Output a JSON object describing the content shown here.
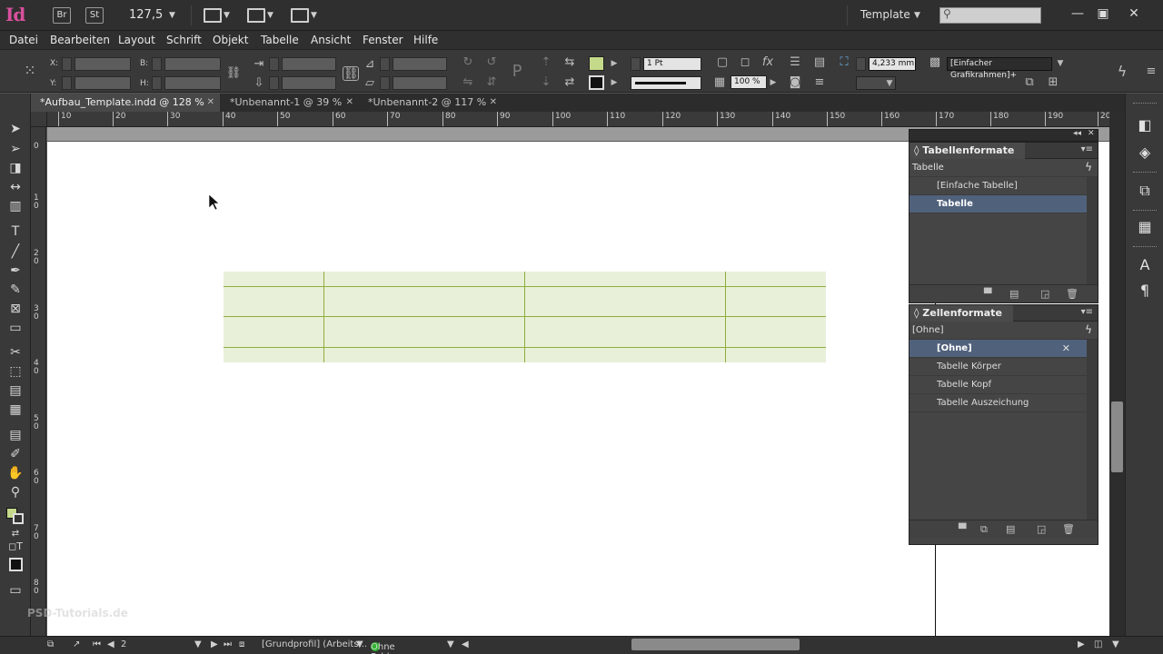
{
  "app": {
    "logo": "Id",
    "bridge_label": "Br",
    "stock_label": "St",
    "zoom": "127,5",
    "workspace": "Template",
    "window_controls": [
      "minimize-icon",
      "restore-icon",
      "close-icon"
    ]
  },
  "menu": [
    "Datei",
    "Bearbeiten",
    "Layout",
    "Schrift",
    "Objekt",
    "Tabelle",
    "Ansicht",
    "Fenster",
    "Hilfe"
  ],
  "control": {
    "x_label": "X:",
    "y_label": "Y:",
    "w_label": "B:",
    "h_label": "H:",
    "stroke_weight": "1 Pt",
    "opacity": "100 %",
    "fitting_value": "4,233 mm",
    "object_style": "[Einfacher Grafikrahmen]+",
    "fill_color": "#c4d98a"
  },
  "tabs": [
    {
      "label": "*Aufbau_Template.indd @ 128 %",
      "active": true
    },
    {
      "label": "*Unbenannt-1 @ 39 %",
      "active": false
    },
    {
      "label": "*Unbenannt-2 @ 117 %",
      "active": false
    }
  ],
  "ruler": {
    "h_ticks": [
      "10",
      "20",
      "30",
      "40",
      "50",
      "60",
      "70",
      "80",
      "90",
      "100",
      "110",
      "120",
      "130",
      "140",
      "150",
      "160",
      "170",
      "180",
      "190",
      "20"
    ],
    "v_ticks": [
      "0",
      "1\n0",
      "2\n0",
      "3\n0",
      "4\n0",
      "5\n0",
      "6\n0",
      "7\n0",
      "8\n0"
    ]
  },
  "table_styles_panel": {
    "title": "Tabellenformate",
    "current": "Tabelle",
    "items": [
      {
        "label": "[Einfache Tabelle]",
        "selected": false
      },
      {
        "label": "Tabelle",
        "selected": true
      }
    ]
  },
  "cell_styles_panel": {
    "title": "Zellenformate",
    "current": "[Ohne]",
    "items": [
      {
        "label": "[Ohne]",
        "selected": true
      },
      {
        "label": "Tabelle Körper",
        "selected": false
      },
      {
        "label": "Tabelle Kopf",
        "selected": false
      },
      {
        "label": "Tabelle Auszeichung",
        "selected": false
      }
    ]
  },
  "document_table": {
    "rows": 4,
    "cols": 4,
    "fill": "#e9f0d9",
    "line": "#8fae3d"
  },
  "status": {
    "page": "2",
    "profile": "[Grundprofil] (Arbeits...",
    "preflight": "Ohne Fehler"
  },
  "watermark": "PSD-Tutorials.de"
}
